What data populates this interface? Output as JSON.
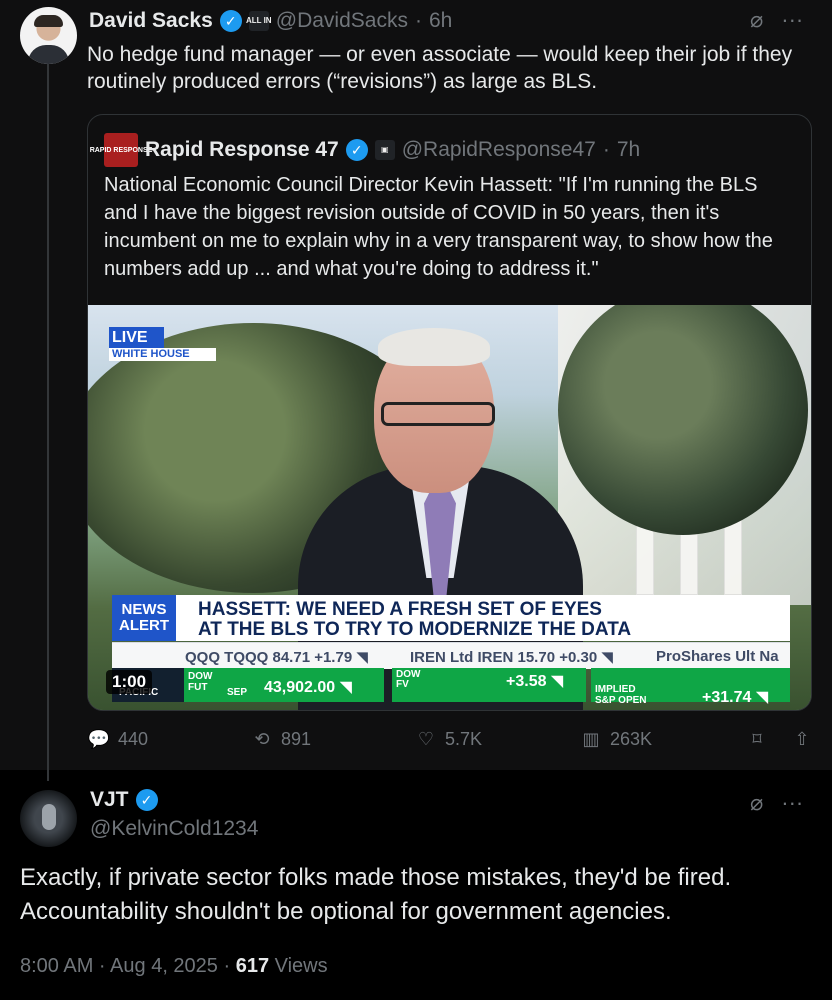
{
  "post": {
    "author": {
      "name": "David Sacks",
      "mini_badge": "ALL IN",
      "handle": "@DavidSacks",
      "age": "6h"
    },
    "text": "No hedge fund manager — or even associate — would keep their job if they routinely produced errors (“revisions”) as large as BLS.",
    "quote": {
      "author": {
        "name": "Rapid Response 47",
        "logo_text": "RAPID RESPONSE",
        "handle": "@RapidResponse47",
        "age": "7h"
      },
      "text": "National Economic Council Director Kevin Hassett: \"If I'm running the BLS and I have the biggest revision outside of COVID in 50 years, then it's incumbent on me to explain why in a very transparent way, to show how the numbers add up ... and what you're doing to address it.\"",
      "video": {
        "live": "LIVE",
        "location": "WHITE HOUSE",
        "alert": "NEWS ALERT",
        "headline_1": "HASSETT: WE NEED A FRESH SET OF EYES",
        "headline_2": "AT THE BLS TO TRY TO MODERNIZE THE DATA",
        "ticker_1": "QQQ TQQQ 84.71 +1.79 ◥",
        "ticker_2": "IREN Ltd IREN 15.70 +0.30 ◥",
        "ticker_3": "ProShares Ult Na",
        "bottom_left_label_1": "DOW",
        "bottom_left_label_2": "FUT",
        "bottom_left_label_3": "SEP",
        "bottom_left_value": "43,902.00 ◥",
        "bottom_mid_label_1": "DOW",
        "bottom_mid_label_2": "FV",
        "bottom_mid_value": "+3.58 ◥",
        "bottom_right_label_1": "IMPLIED",
        "bottom_right_label_2": "S&P OPEN",
        "bottom_right_value": "+31.74 ◥",
        "network_small": "PACIFIC",
        "duration": "1:00"
      }
    },
    "metrics": {
      "replies": "440",
      "reposts": "891",
      "likes": "5.7K",
      "views": "263K"
    }
  },
  "reply": {
    "author": {
      "name": "VJT",
      "handle": "@KelvinCold1234"
    },
    "text": "Exactly, if private sector folks made those mistakes, they'd be fired. Accountability shouldn't be optional for government agencies.",
    "meta": {
      "time": "8:00 AM · Aug 4, 2025 · ",
      "views_count": "617",
      "views_label": " Views"
    }
  },
  "colors": {
    "background": "#000000",
    "text": "#e7e9ea",
    "muted": "#71767b",
    "verified": "#1d9bf0",
    "border": "#2f3336"
  },
  "icons": {
    "grok": "grok-icon",
    "more": "more-icon",
    "reply": "reply-icon",
    "repost": "repost-icon",
    "like": "heart-icon",
    "views": "views-icon",
    "bookmark": "bookmark-icon",
    "share": "share-icon"
  }
}
